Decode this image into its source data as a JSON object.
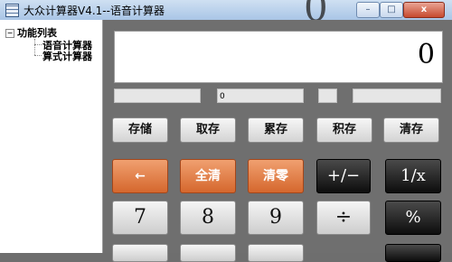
{
  "window": {
    "title": "大众计算器V4.1--语音计算器",
    "bg_digit": "0"
  },
  "window_controls": {
    "minimize": "–",
    "maximize": "□",
    "close": "x"
  },
  "tree": {
    "expander": "−",
    "root": "功能列表",
    "items": [
      {
        "label": "语音计算器"
      },
      {
        "label": "算式计算器"
      }
    ]
  },
  "display": {
    "value": "0"
  },
  "status": {
    "memory_value": "0"
  },
  "memory_buttons": [
    {
      "label": "存储"
    },
    {
      "label": "取存"
    },
    {
      "label": "累存"
    },
    {
      "label": "积存"
    },
    {
      "label": "清存"
    }
  ],
  "row1": {
    "backspace": "←",
    "clear_all": "全清",
    "clear_entry": "清零",
    "negate": "+/−",
    "reciprocal": "1/x"
  },
  "row2": {
    "seven": "7",
    "eight": "8",
    "nine": "9",
    "divide": "÷",
    "percent": "%"
  }
}
